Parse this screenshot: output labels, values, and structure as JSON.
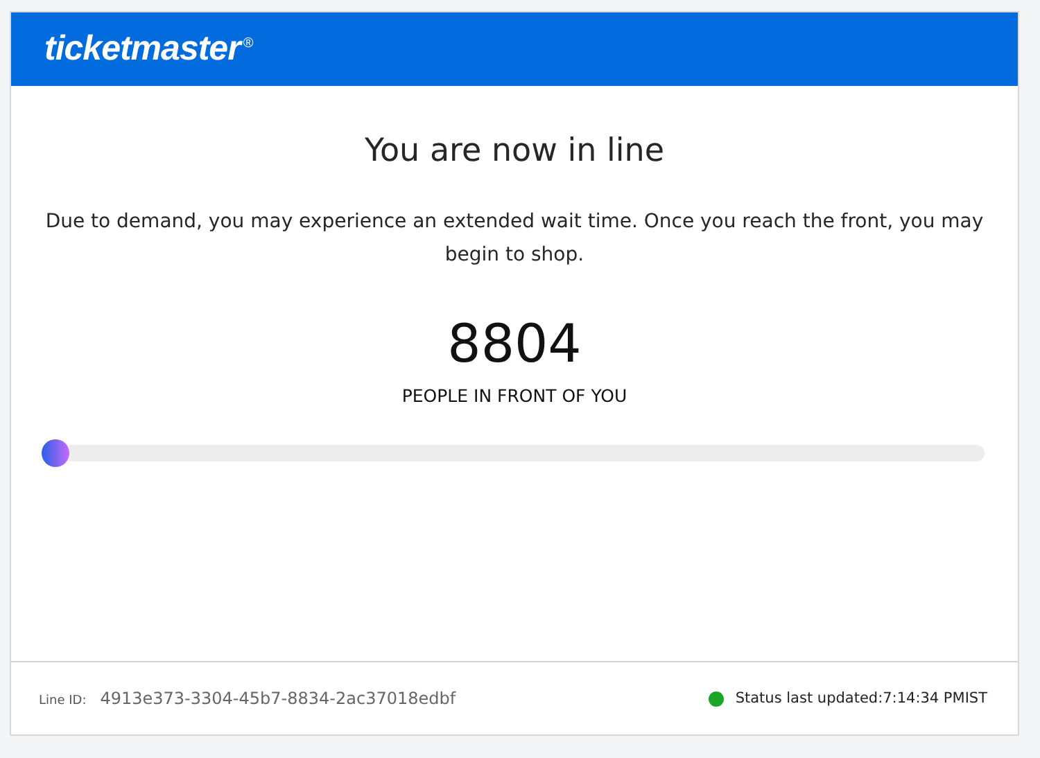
{
  "header": {
    "logo": "ticketmaster",
    "trademark": "®"
  },
  "title": "You are now in line",
  "message": "Due to demand, you may experience an extended wait time. Once you reach the front, you may begin to shop.",
  "queue": {
    "count": "8804",
    "caption": "PEOPLE IN FRONT OF YOU",
    "level": 0
  },
  "footer": {
    "line_id_label": "Line ID:",
    "line_id": "4913e373-3304-45b7-8834-2ac37018edbf",
    "status": "Status last updated:7:14:34 PMIST"
  }
}
